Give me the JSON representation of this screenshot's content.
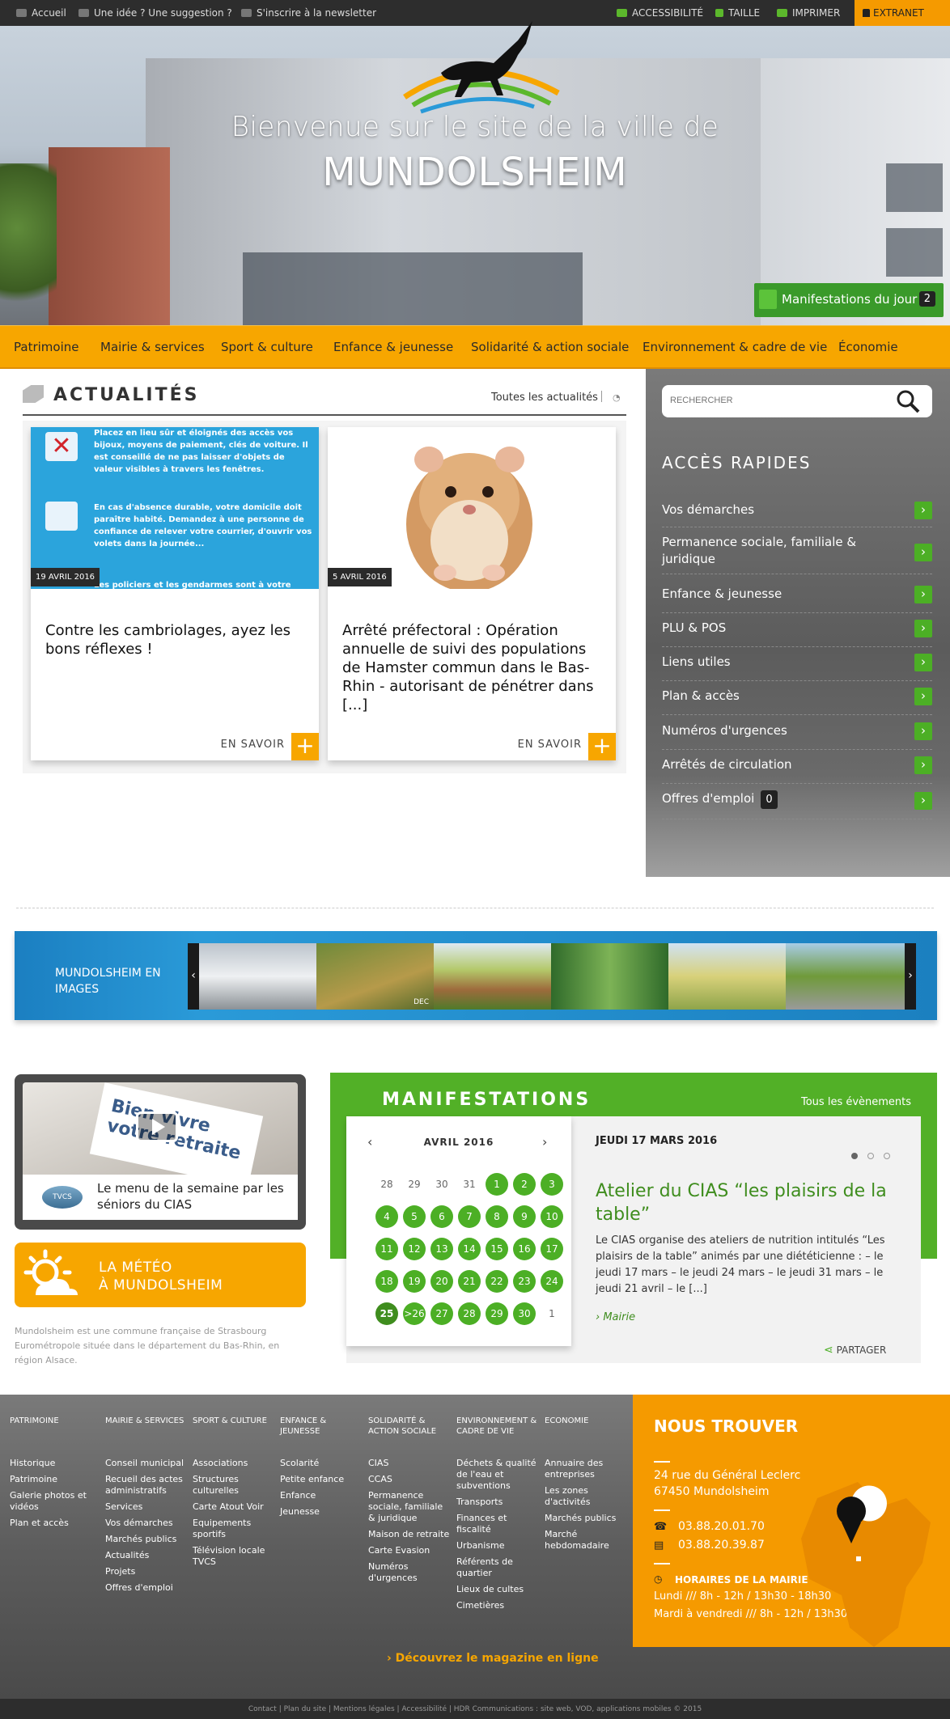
{
  "topbar": {
    "home": "Accueil",
    "idea": "Une idée ? Une suggestion ?",
    "newsletter": "S'inscrire à la newsletter",
    "accessibility": "ACCESSIBILITÉ",
    "size": "TAILLE",
    "print": "IMPRIMER",
    "extranet": "EXTRANET"
  },
  "hero": {
    "line1": "Bienvenue sur le site de la ville de",
    "line2": "MUNDOLSHEIM",
    "manif_label": "Manifestations du jour",
    "manif_count": "2"
  },
  "nav": [
    "Patrimoine",
    "Mairie & services",
    "Sport & culture",
    "Enfance & jeunesse",
    "Solidarité & action sociale",
    "Environnement & cadre de vie",
    "Économie"
  ],
  "actualites": {
    "title": "ACTUALITÉS",
    "all": "Toutes les actualités",
    "cards": [
      {
        "date": "19 AVRIL 2016",
        "title": "Contre les cambriolages, ayez les bons réflexes !",
        "more": "EN SAVOIR",
        "img_lines": [
          "Placez en lieu sûr et éloignés des accès vos bijoux, moyens de paiement, clés de voiture. Il est conseillé de ne pas laisser d'objets de valeur visibles à travers les fenêtres.",
          "En cas d'absence durable, votre domicile doit paraître habité. Demandez à une personne de confiance de relever votre courrier, d'ouvrir vos volets dans la journée...",
          "Les policiers et les gendarmes sont à votre"
        ]
      },
      {
        "date": "5 AVRIL 2016",
        "title": "Arrêté préfectoral : Opération annuelle de suivi des populations de Hamster commun dans le Bas-Rhin - autorisant de pénétrer dans [...]",
        "more": "EN SAVOIR"
      }
    ]
  },
  "sidebar": {
    "search_placeholder": "RECHERCHER",
    "title": "ACCÈS RAPIDES",
    "items": [
      {
        "label": "Vos démarches"
      },
      {
        "label": "Permanence sociale, familiale & juridique"
      },
      {
        "label": "Enfance & jeunesse"
      },
      {
        "label": "PLU & POS"
      },
      {
        "label": "Liens utiles"
      },
      {
        "label": "Plan & accès"
      },
      {
        "label": "Numéros d'urgences"
      },
      {
        "label": "Arrêtés de circulation"
      },
      {
        "label": "Offres d'emploi",
        "badge": "0"
      }
    ]
  },
  "images": {
    "title": "MUNDOLSHEIM EN IMAGES",
    "next_label": "DEC"
  },
  "video": {
    "caption": "Le menu de la semaine par les séniors du CIAS",
    "logo": "TVCS",
    "img_text": "Bien vivre votre retraite"
  },
  "meteo": {
    "line1": "LA MÉTÉO",
    "line2": "À MUNDOLSHEIM"
  },
  "intro": "Mundolsheim est une commune française de Strasbourg Eurométropole située dans le département du Bas-Rhin, en région Alsace.",
  "manifestations": {
    "title": "MANIFESTATIONS",
    "all": "Tous les évènements",
    "calendar": {
      "month": "AVRIL 2016",
      "weeks": [
        [
          {
            "d": "28"
          },
          {
            "d": "29"
          },
          {
            "d": "30"
          },
          {
            "d": "31"
          },
          {
            "d": "1",
            "e": true
          },
          {
            "d": "2",
            "e": true
          },
          {
            "d": "3",
            "e": true
          }
        ],
        [
          {
            "d": "4",
            "e": true
          },
          {
            "d": "5",
            "e": true
          },
          {
            "d": "6",
            "e": true
          },
          {
            "d": "7",
            "e": true
          },
          {
            "d": "8",
            "e": true
          },
          {
            "d": "9",
            "e": true
          },
          {
            "d": "10",
            "e": true
          }
        ],
        [
          {
            "d": "11",
            "e": true
          },
          {
            "d": "12",
            "e": true
          },
          {
            "d": "13",
            "e": true
          },
          {
            "d": "14",
            "e": true
          },
          {
            "d": "15",
            "e": true
          },
          {
            "d": "16",
            "e": true
          },
          {
            "d": "17",
            "e": true
          }
        ],
        [
          {
            "d": "18",
            "e": true
          },
          {
            "d": "19",
            "e": true
          },
          {
            "d": "20",
            "e": true
          },
          {
            "d": "21",
            "e": true
          },
          {
            "d": "22",
            "e": true
          },
          {
            "d": "23",
            "e": true
          },
          {
            "d": "24",
            "e": true
          }
        ],
        [
          {
            "d": "25",
            "t": true
          },
          {
            "d": ">26",
            "e": true
          },
          {
            "d": "27",
            "e": true
          },
          {
            "d": "28",
            "e": true
          },
          {
            "d": "29",
            "e": true
          },
          {
            "d": "30",
            "e": true
          },
          {
            "d": "1"
          }
        ]
      ]
    },
    "event": {
      "date": "JEUDI 17 MARS 2016",
      "title": "Atelier du CIAS “les plaisirs de la table”",
      "desc": "Le CIAS organise des ateliers de nutrition intitulés “Les plaisirs de la table” animés par une diététicienne : – le jeudi 17 mars – le jeudi 24 mars – le jeudi 31 mars – le jeudi 21 avril – le [...]",
      "category": "Mairie",
      "share": "PARTAGER"
    }
  },
  "footer": {
    "cols": [
      {
        "title": "PATRIMOINE",
        "links": [
          "Historique",
          "Patrimoine",
          "Galerie photos et vidéos",
          "Plan et accès"
        ]
      },
      {
        "title": "MAIRIE & SERVICES",
        "links": [
          "Conseil municipal",
          "Recueil des actes administratifs",
          "Services",
          "Vos démarches",
          "Marchés publics",
          "Actualités",
          "Projets",
          "Offres d'emploi"
        ]
      },
      {
        "title": "SPORT & CULTURE",
        "links": [
          "Associations",
          "Structures culturelles",
          "Carte Atout Voir",
          "Equipements sportifs",
          "Télévision locale TVCS"
        ]
      },
      {
        "title": "ENFANCE & JEUNESSE",
        "links": [
          "Scolarité",
          "Petite enfance",
          "Enfance",
          "Jeunesse"
        ]
      },
      {
        "title": "SOLIDARITÉ & ACTION SOCIALE",
        "links": [
          "CIAS",
          "CCAS",
          "Permanence sociale, familiale & juridique",
          "Maison de retraite",
          "Carte Evasion",
          "Numéros d'urgences"
        ]
      },
      {
        "title": "ENVIRONNEMENT & CADRE DE VIE",
        "links": [
          "Déchets & qualité de l'eau et subventions",
          "Transports",
          "Finances et fiscalité",
          "Urbanisme",
          "Référents de quartier",
          "Lieux de cultes",
          "Cimetières"
        ]
      },
      {
        "title": "ECONOMIE",
        "links": [
          "Annuaire des entreprises",
          "Les zones d'activités",
          "Marchés publics",
          "Marché hebdomadaire"
        ]
      }
    ],
    "magazine": "Découvrez le magazine en ligne",
    "find": {
      "title": "NOUS TROUVER",
      "addr1": "24 rue du Général Leclerc",
      "addr2": "67450 Mundolsheim",
      "phone": "03.88.20.01.70",
      "fax": "03.88.20.39.87",
      "hours_title": "HORAIRES DE LA MAIRIE",
      "hours1": "Lundi /// 8h - 12h / 13h30 - 18h30",
      "hours2": "Mardi à vendredi /// 8h - 12h / 13h30 - 17h"
    },
    "bottom": "Contact | Plan du site | Mentions légales | Accessibilité | HDR Communications : site web, VOD, applications mobiles © 2015"
  },
  "colors": {
    "orange": "#f7a600",
    "green": "#4caf25",
    "dark": "#2d2d2d",
    "blue": "#1b7fc1"
  }
}
